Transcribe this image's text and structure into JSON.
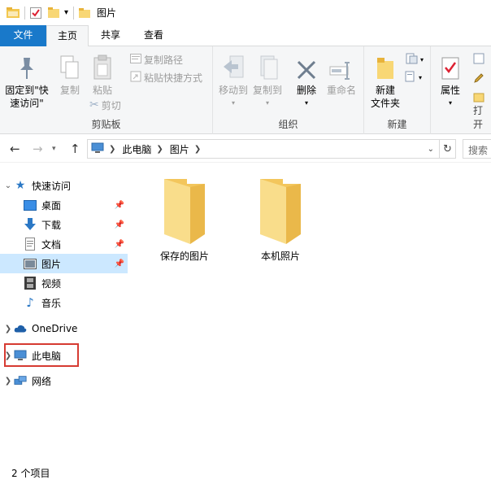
{
  "window": {
    "title": "图片"
  },
  "ribbon_tabs": [
    "文件",
    "主页",
    "共享",
    "查看"
  ],
  "ribbon": {
    "clipboard": {
      "pin_quick_access": "固定到\"快\n速访问\"",
      "copy": "复制",
      "paste": "粘贴",
      "copy_path": "复制路径",
      "paste_shortcut": "粘贴快捷方式",
      "cut": "剪切",
      "label": "剪贴板"
    },
    "organize": {
      "move_to": "移动到",
      "copy_to": "复制到",
      "delete": "删除",
      "rename": "重命名",
      "label": "组织"
    },
    "new": {
      "new_folder": "新建\n文件夹",
      "label": "新建"
    },
    "open": {
      "properties": "属性",
      "label": "打开"
    }
  },
  "address": {
    "crumbs": [
      "此电脑",
      "图片"
    ],
    "search_placeholder": "搜索"
  },
  "nav_pane": {
    "quick_access": "快速访问",
    "items": [
      {
        "label": "桌面",
        "pinned": true
      },
      {
        "label": "下载",
        "pinned": true
      },
      {
        "label": "文档",
        "pinned": true
      },
      {
        "label": "图片",
        "pinned": true,
        "selected": true
      },
      {
        "label": "视频",
        "pinned": false
      },
      {
        "label": "音乐",
        "pinned": false
      }
    ],
    "onedrive": "OneDrive",
    "this_pc": "此电脑",
    "network": "网络"
  },
  "files": [
    {
      "name": "保存的图片",
      "type": "folder"
    },
    {
      "name": "本机照片",
      "type": "folder"
    }
  ],
  "status": {
    "item_count": "2 个项目"
  },
  "colors": {
    "accent": "#1979ca",
    "selection": "#cce8ff",
    "highlight_border": "#d63b32",
    "folder": "#f8d775"
  }
}
